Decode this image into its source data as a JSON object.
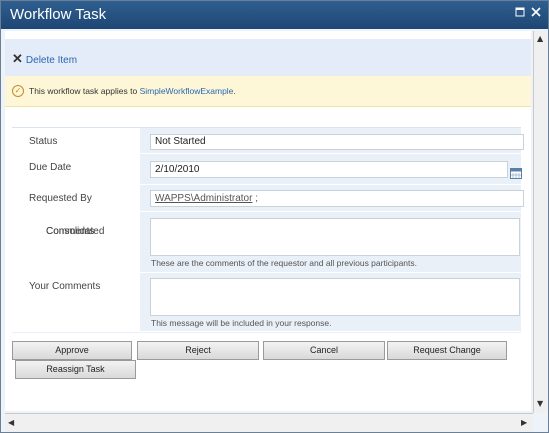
{
  "window": {
    "title": "Workflow Task",
    "controls": [
      "maximize",
      "close"
    ]
  },
  "ribbon": {
    "delete_label": "Delete Item"
  },
  "notice": {
    "text": "This workflow task applies to",
    "link": "SimpleWorkflowExample",
    "suffix": "."
  },
  "form": {
    "status": {
      "label": "Status",
      "value": "Not Started"
    },
    "due_date": {
      "label": "Due Date",
      "value": "2/10/2010"
    },
    "requested_by": {
      "label": "Requested By",
      "value": "WAPPS\\Administrator",
      "suffix": ";"
    },
    "consolidated_comments": {
      "label": [
        "Consolidated",
        "Comments"
      ],
      "hint": "These are the comments of the requestor and all previous participants."
    },
    "your_comments": {
      "label": "Your Comments",
      "hint": "This message will be included in your response."
    }
  },
  "buttons": {
    "approve": "Approve",
    "reject": "Reject",
    "cancel": "Cancel",
    "request_change": "Request Change",
    "reassign": "Reassign Task"
  }
}
